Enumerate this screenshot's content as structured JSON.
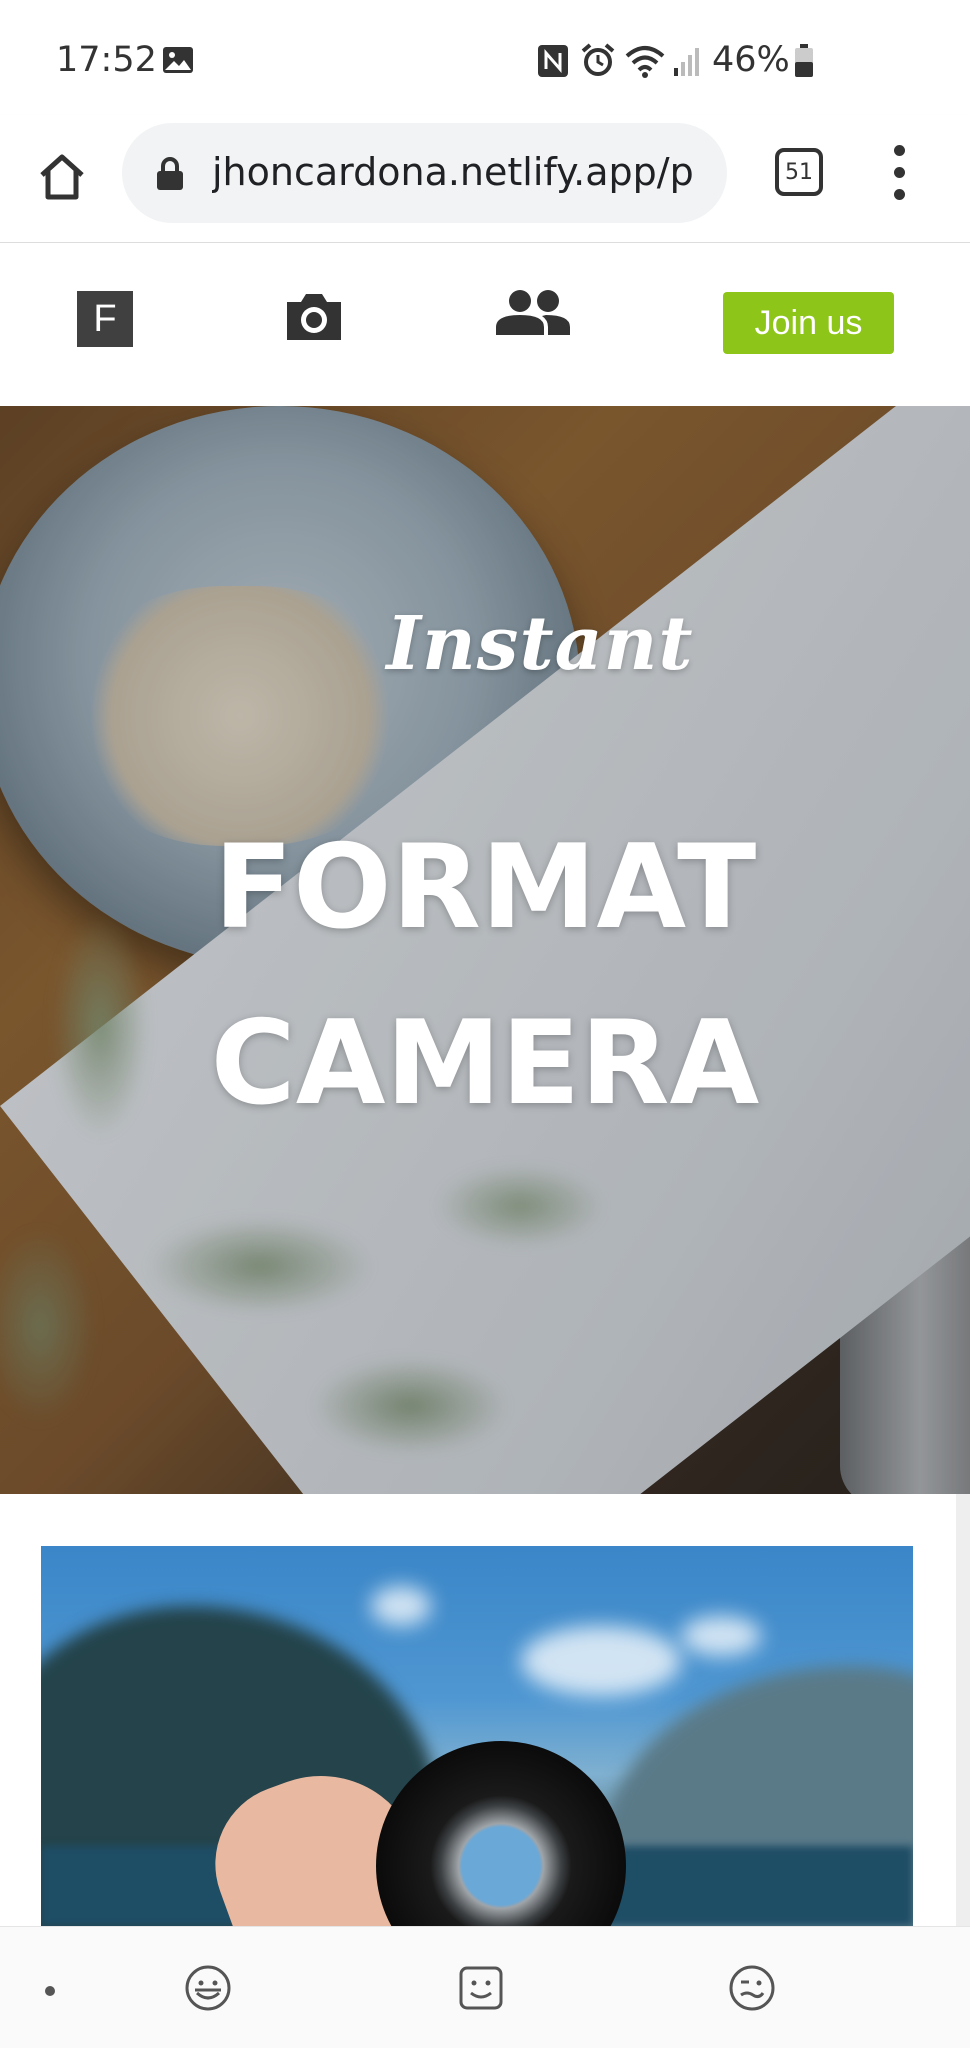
{
  "status_bar": {
    "time": "17:52",
    "battery": "46%",
    "icons": [
      "gallery-icon",
      "nfc-icon",
      "alarm-icon",
      "wifi-icon",
      "signal-icon",
      "battery-icon"
    ]
  },
  "browser": {
    "url": "jhoncardona.netlify.app/p",
    "tab_count": "51"
  },
  "site_nav": {
    "logo_letter": "F",
    "join_label": "Join us",
    "accent_color": "#8dc518"
  },
  "hero": {
    "script_text": "Instant",
    "title_line1": "FORMAT",
    "title_line2": "CAMERA"
  },
  "bottom_bar": {
    "icons": [
      "dot-icon",
      "emoji-smile-icon",
      "emoji-face-icon",
      "emoji-wink-icon"
    ]
  }
}
